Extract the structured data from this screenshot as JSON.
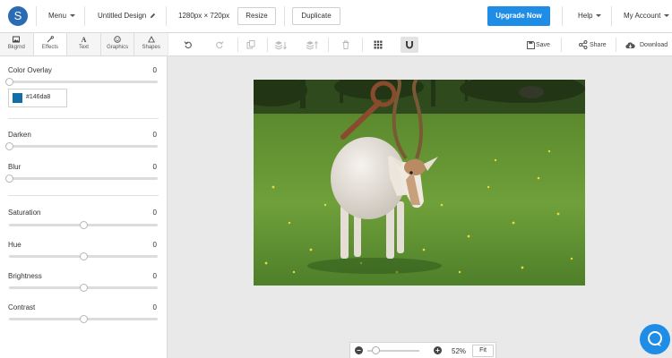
{
  "topbar": {
    "logo_letter": "S",
    "menu_label": "Menu",
    "design_name": "Untitled Design",
    "dimensions": "1280px × 720px",
    "resize_label": "Resize",
    "duplicate_label": "Duplicate",
    "upgrade_label": "Upgrade Now",
    "help_label": "Help",
    "account_label": "My Account"
  },
  "tabs": [
    {
      "label": "Bkgrnd",
      "icon": "image-icon"
    },
    {
      "label": "Effects",
      "icon": "wand-icon"
    },
    {
      "label": "Text",
      "icon": "text-icon"
    },
    {
      "label": "Graphics",
      "icon": "smiley-icon"
    },
    {
      "label": "Shapes",
      "icon": "triangle-icon"
    }
  ],
  "effects": {
    "color_overlay": {
      "label": "Color Overlay",
      "value": "0",
      "level": 0,
      "color": "#146da8",
      "color_text": "#146da8"
    },
    "darken": {
      "label": "Darken",
      "value": "0",
      "level": 0
    },
    "blur": {
      "label": "Blur",
      "value": "0",
      "level": 0
    },
    "saturation": {
      "label": "Saturation",
      "value": "0",
      "level": 0.5
    },
    "hue": {
      "label": "Hue",
      "value": "0",
      "level": 0.5
    },
    "brightness": {
      "label": "Brightness",
      "value": "0",
      "level": 0.5
    },
    "contrast": {
      "label": "Contrast",
      "value": "0",
      "level": 0.5
    }
  },
  "toolbar": {
    "save_label": "Save",
    "share_label": "Share",
    "download_label": "Download"
  },
  "zoom": {
    "percent": "52%",
    "fit_label": "Fit",
    "minus": "−",
    "plus": "+"
  },
  "colors": {
    "brand": "#2b6bb3",
    "accent": "#1f8ce6"
  }
}
